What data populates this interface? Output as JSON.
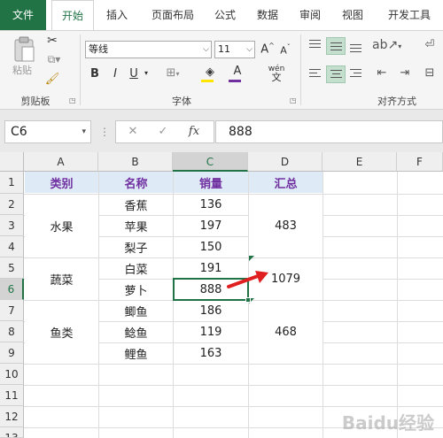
{
  "tabs": [
    "文件",
    "开始",
    "插入",
    "页面布局",
    "公式",
    "数据",
    "审阅",
    "视图",
    "开发工具"
  ],
  "ribbon": {
    "clipboard": {
      "paste_label": "粘贴",
      "group_label": "剪贴板"
    },
    "font": {
      "font_name": "等线",
      "font_size": "11",
      "grow": "A",
      "shrink": "A",
      "bold": "B",
      "italic": "I",
      "underline": "U",
      "phonetic_label": "wén",
      "group_label": "字体"
    },
    "alignment": {
      "group_label": "对齐方式"
    }
  },
  "formula_bar": {
    "name_box": "C6",
    "fx_label": "fx",
    "value": "888"
  },
  "columns": [
    "A",
    "B",
    "C",
    "D",
    "E",
    "F"
  ],
  "rows": [
    "1",
    "2",
    "3",
    "4",
    "5",
    "6",
    "7",
    "8",
    "9",
    "10",
    "11",
    "12",
    "13"
  ],
  "header_row": {
    "a": "类别",
    "b": "名称",
    "c": "销量",
    "d": "汇总"
  },
  "groups": [
    {
      "category": "水果",
      "total": "483"
    },
    {
      "category": "蔬菜",
      "total": "1079"
    },
    {
      "category": "鱼类",
      "total": "468"
    }
  ],
  "items": [
    {
      "name": "香蕉",
      "sales": "136"
    },
    {
      "name": "苹果",
      "sales": "197"
    },
    {
      "name": "梨子",
      "sales": "150"
    },
    {
      "name": "白菜",
      "sales": "191"
    },
    {
      "name": "萝卜",
      "sales": "888"
    },
    {
      "name": "鲫鱼",
      "sales": "186"
    },
    {
      "name": "鲶鱼",
      "sales": "119"
    },
    {
      "name": "鲤鱼",
      "sales": "163"
    }
  ],
  "watermark": "Baidu经验",
  "colors": {
    "accent": "#217346",
    "header_fill": "#deeaf6",
    "header_text": "#7030a0",
    "arrow": "#e02020"
  }
}
